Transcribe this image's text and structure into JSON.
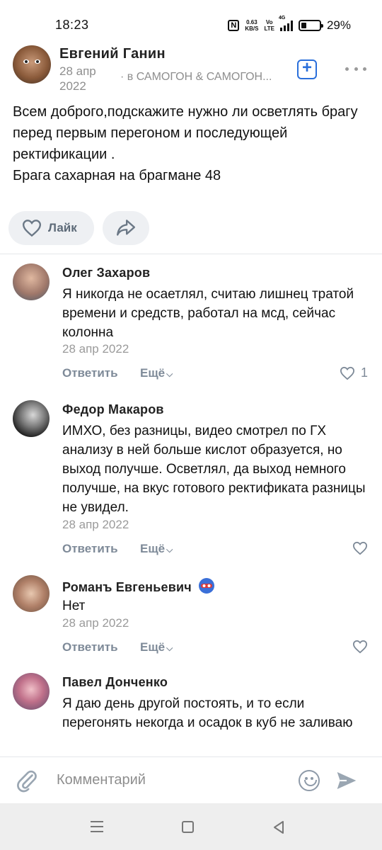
{
  "status_bar": {
    "time": "18:23",
    "speed_value": "0.63",
    "speed_unit": "KB/S",
    "volte_top": "Vo",
    "volte_bottom": "LTE",
    "network": "4G",
    "battery_percent": "29%",
    "battery_level": 0.29
  },
  "post": {
    "author": "Евгений Ганин",
    "date": "28 апр 2022",
    "group": "· в САМОГОН & САМОГОН...",
    "text": "Всем доброго,подскажите нужно ли осветлять брагу перед первым перегоном и последующей ректификации .\nБрага сахарная на брагмане 48",
    "like_label": "Лайк",
    "add_icon": "plus-square-icon",
    "more_icon": "more-horizontal-icon"
  },
  "comments": [
    {
      "name": "Олег Захаров",
      "text": "Я никогда не осаетлял, считаю лишнец тратой времени и средств, работал на мсд, сейчас колонна",
      "date": "28 апр 2022",
      "reply": "Ответить",
      "more": "Ещё",
      "likes": "1"
    },
    {
      "name": "Федор Макаров",
      "text": "ИМХО, без разницы, видео смотрел по ГХ анализу в ней больше кислот образуется, но выход получше. Осветлял, да выход немного получше, на вкус готового ректификата разницы не увидел.",
      "date": "28 апр 2022",
      "reply": "Ответить",
      "more": "Ещё",
      "likes": ""
    },
    {
      "name": "Романъ Евгеньевич",
      "text": "Нет",
      "date": "28 апр 2022",
      "reply": "Ответить",
      "more": "Ещё",
      "likes": ""
    },
    {
      "name": "Павел Донченко",
      "text": "Я даю день другой постоять, и то если перегонять некогда и осадок в куб не заливаю",
      "date": "",
      "reply": "",
      "more": "",
      "likes": ""
    }
  ],
  "input": {
    "placeholder": "Комментарий"
  },
  "colors": {
    "accent": "#2a6fdb",
    "muted": "#8e8e8e",
    "action": "#7e8a98",
    "button_bg": "#eef0f3"
  }
}
